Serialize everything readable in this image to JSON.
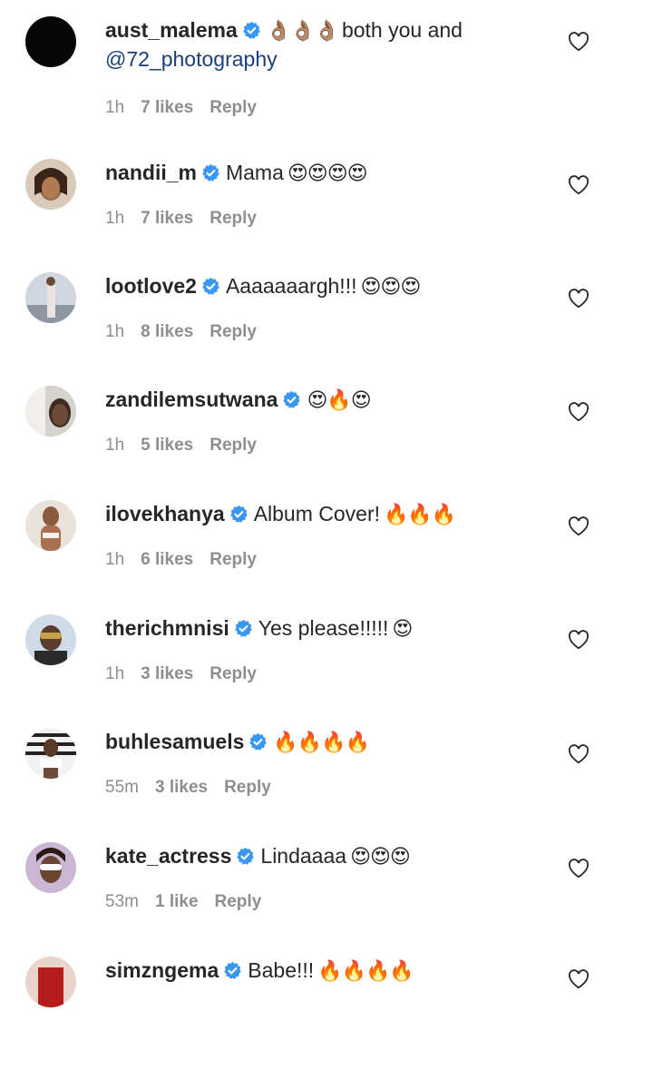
{
  "comments": [
    {
      "username": "aust_malema",
      "text": "both you and",
      "mention": "@72_photography",
      "emoji": "👌🏽👌🏽👌🏽",
      "emoji_first": true,
      "time": "1h",
      "likes": "7 likes",
      "reply": "Reply",
      "avatar_style": "dark"
    },
    {
      "username": "nandii_m",
      "text": "Mama",
      "emoji": "😍😍😍😍",
      "time": "1h",
      "likes": "7 likes",
      "reply": "Reply",
      "avatar_style": "portrait-warm"
    },
    {
      "username": "lootlove2",
      "text": "Aaaaaaargh!!!",
      "emoji": "😍😍😍",
      "time": "1h",
      "likes": "8 likes",
      "reply": "Reply",
      "avatar_style": "portrait-light"
    },
    {
      "username": "zandilemsutwana",
      "text": "",
      "emoji": "😍🔥😍",
      "time": "1h",
      "likes": "5 likes",
      "reply": "Reply",
      "avatar_style": "portrait-gray"
    },
    {
      "username": "ilovekhanya",
      "text": "Album Cover!",
      "emoji": "🔥🔥🔥",
      "time": "1h",
      "likes": "6 likes",
      "reply": "Reply",
      "avatar_style": "portrait-beige"
    },
    {
      "username": "therichmnisi",
      "text": "Yes please!!!!!",
      "emoji": "😍",
      "time": "1h",
      "likes": "3 likes",
      "reply": "Reply",
      "avatar_style": "portrait-sky"
    },
    {
      "username": "buhlesamuels",
      "text": "",
      "emoji": "🔥🔥🔥🔥",
      "time": "55m",
      "likes": "3 likes",
      "reply": "Reply",
      "avatar_style": "portrait-stripes"
    },
    {
      "username": "kate_actress",
      "text": "Lindaaaa",
      "emoji": "😍😍😍",
      "time": "53m",
      "likes": "1 like",
      "reply": "Reply",
      "avatar_style": "portrait-purple"
    },
    {
      "username": "simzngema",
      "text": "Babe!!!",
      "emoji": "🔥🔥🔥🔥",
      "time": "",
      "likes": "",
      "reply": "",
      "avatar_style": "portrait-red"
    }
  ],
  "colors": {
    "verified": "#3897f0",
    "mention": "#1a3f75",
    "meta": "#8e8e8e",
    "text": "#262626"
  },
  "icons": {
    "verified": "verified-badge-icon",
    "like": "heart-outline-icon"
  }
}
